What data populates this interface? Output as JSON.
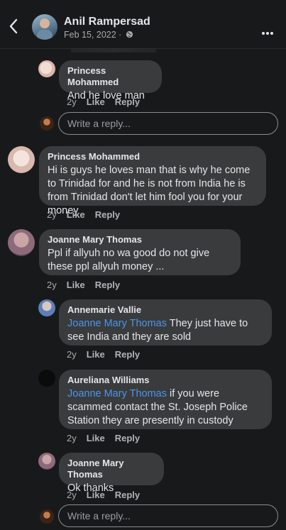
{
  "header": {
    "name": "Anil Rampersad",
    "date": "Feb 15, 2022 · "
  },
  "comments": [
    {
      "author": "Princess Mohammed",
      "text": "And he love man",
      "time": "2y",
      "like": "Like",
      "reply": "Reply"
    },
    {
      "author": "Princess Mohammed",
      "text": "Hi is guys he loves man that is why he come to Trinidad for and he is not from India he is from Trinidad don't let him fool you for your money",
      "time": "2y",
      "like": "Like",
      "reply": "Reply"
    },
    {
      "author": "Joanne Mary Thomas",
      "text": "Ppl if allyuh no wa good do not give these ppl allyuh money ...",
      "time": "2y",
      "like": "Like",
      "reply": "Reply"
    },
    {
      "author": "Annemarie Vallie",
      "mention": "Joanne Mary Thomas",
      "text": " They just have to see India and they are sold",
      "time": "2y",
      "like": "Like",
      "reply": "Reply"
    },
    {
      "author": "Aureliana Williams",
      "mention": "Joanne Mary Thomas",
      "text": " if you were scammed contact the St. Joseph  Police Station  they are presently in custody",
      "time": "2y",
      "like": "Like",
      "reply": "Reply"
    },
    {
      "author": "Joanne Mary Thomas",
      "text": "Ok thanks",
      "time": "2y",
      "like": "Like",
      "reply": "Reply"
    }
  ],
  "reply_input": {
    "placeholder": "Write a reply..."
  },
  "icons": {
    "back": "chevron-left-icon",
    "more": "more-dots-icon",
    "privacy": "globe-icon"
  },
  "colors": {
    "background": "#18191a",
    "bubble": "#3a3b3c",
    "mention": "#4b95ea"
  }
}
